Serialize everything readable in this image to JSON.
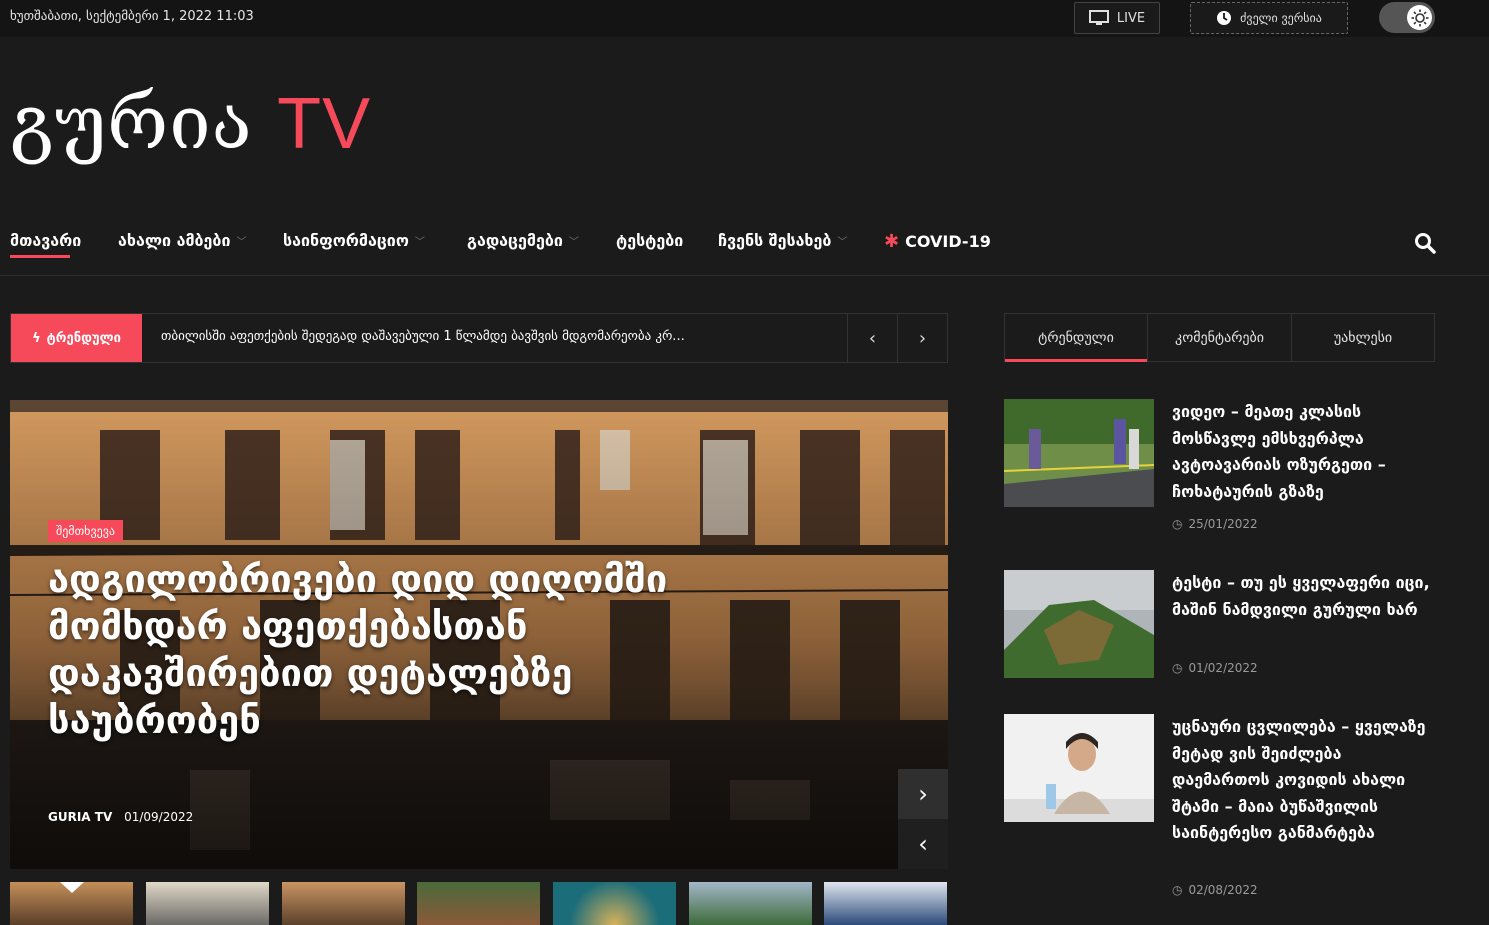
{
  "topbar": {
    "date": "ხუთშაბათი, სექტემბერი 1, 2022 11:03",
    "live_label": "LIVE",
    "old_version_label": "ძველი ვერსია"
  },
  "logo": {
    "name": "გურია",
    "tv": "TV"
  },
  "nav": {
    "items": [
      {
        "label": "მთავარი",
        "has_dropdown": false
      },
      {
        "label": "ახალი ამბები",
        "has_dropdown": true
      },
      {
        "label": "საინფორმაციო",
        "has_dropdown": true
      },
      {
        "label": "გადაცემები",
        "has_dropdown": true
      },
      {
        "label": "ტესტები",
        "has_dropdown": false
      },
      {
        "label": "ჩვენს შესახებ",
        "has_dropdown": true
      },
      {
        "label": "COVID-19",
        "has_dropdown": false
      }
    ]
  },
  "ticker": {
    "badge": "ტრენდული",
    "headline": "თბილისში აფეთქების შედეგად დაშავებული 1 წლამდე ბავშვის მდგომარეობა კრ..."
  },
  "hero": {
    "category": "შემთხვევა",
    "title": "ადგილობრივები დიდ დიღომში მომხდარ აფეთქებასთან დაკავშირებით დეტალებზე საუბრობენ",
    "author": "GURIA TV",
    "date": "01/09/2022"
  },
  "tabs": [
    "ტრენდული",
    "კომენტარები",
    "უახლესი"
  ],
  "side_articles": [
    {
      "title": "ვიდეო – მეათე კლასის მოსწავლე ემსხვერპლა ავტოავარიას ოზურგეთი – ჩოხატაურის გზაზე",
      "date": "25/01/2022"
    },
    {
      "title": "ტესტი – თუ ეს ყველაფერი იცი, მაშინ ნამდვილი გურული ხარ",
      "date": "01/02/2022"
    },
    {
      "title": "უცნაური ცვლილება – ყველაზე მეტად ვის შეიძლება დაემართოს კოვიდის ახალი შტამი – მაია ბუწაშვილის საინტერესო განმარტება",
      "date": "02/08/2022"
    }
  ],
  "colors": {
    "accent": "#f64a5b",
    "background": "#1b1b1b",
    "topbar": "#141414"
  }
}
